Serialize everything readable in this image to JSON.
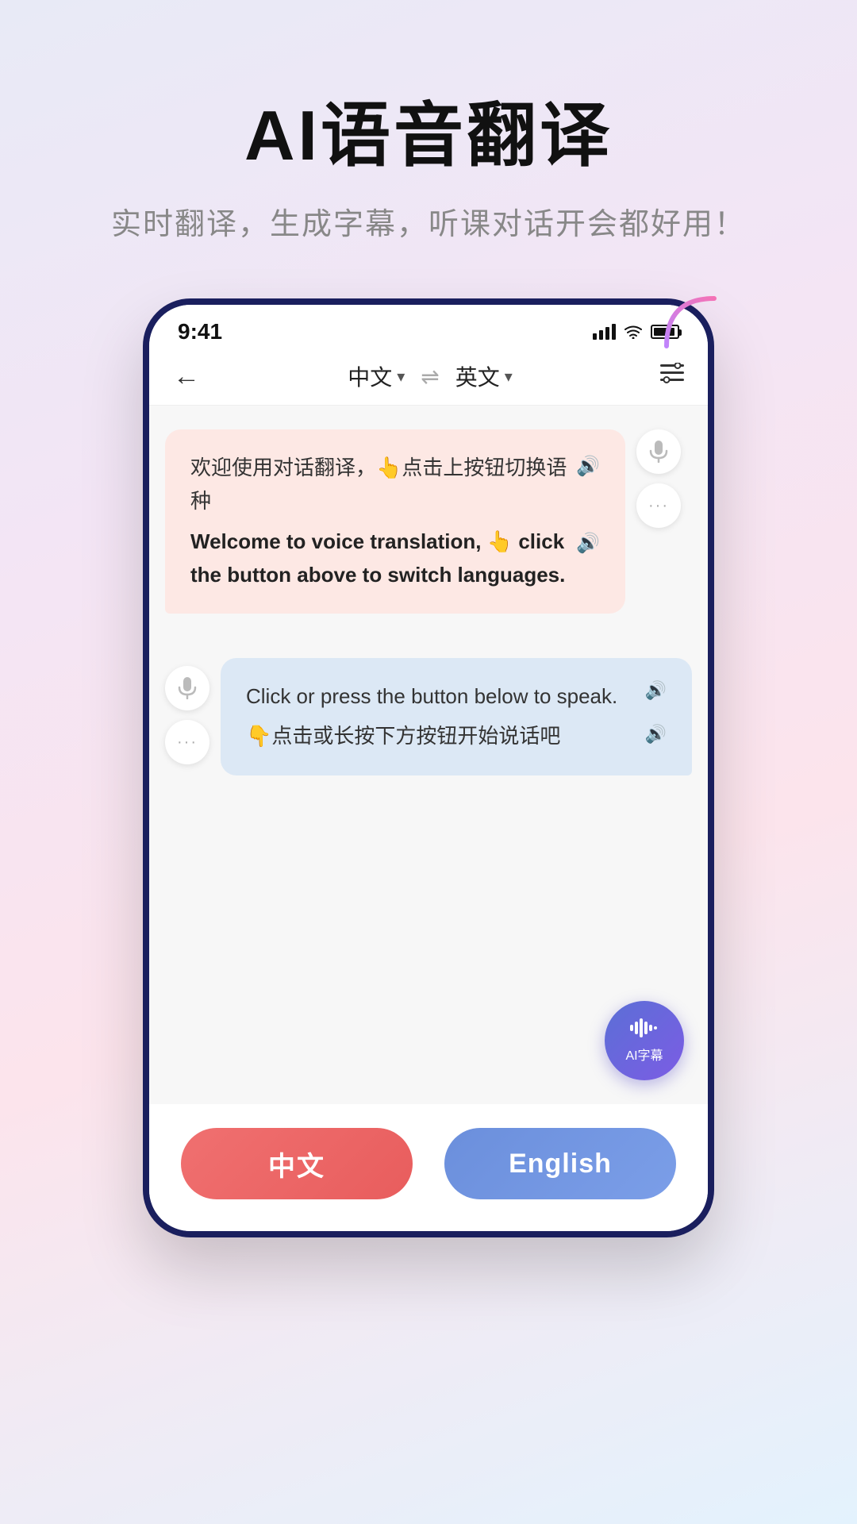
{
  "header": {
    "title": "AI语音翻译",
    "subtitle": "实时翻译，生成字幕，听课对话开会都好用！"
  },
  "phone": {
    "status_time": "9:41",
    "nav": {
      "back_icon": "←",
      "lang_left": "中文",
      "lang_left_arrow": "▾",
      "swap_icon": "⇌",
      "lang_right": "英文",
      "lang_right_arrow": "▾",
      "settings_icon": "≡"
    },
    "bubble_left": {
      "text_cn": "欢迎使用对话翻译，👆点击上按钮切换语种",
      "text_en": "Welcome to voice translation, 👆 click the button above to switch languages.",
      "sound_icon": "🔊"
    },
    "bubble_right": {
      "text_en": "Click or press the button below to speak.",
      "text_cn": "👇点击或长按下方按钮开始说话吧",
      "sound_icon_en": "🔊",
      "sound_icon_cn": "🔊"
    },
    "action_buttons": {
      "mic_icon": "🎤",
      "more_icon": "···"
    },
    "fab": {
      "label": "AI字幕"
    },
    "bottom": {
      "btn_chinese": "中文",
      "btn_english": "English"
    }
  },
  "deco": {
    "arc_color1": "#c084fc",
    "arc_color2": "#f472b6"
  }
}
